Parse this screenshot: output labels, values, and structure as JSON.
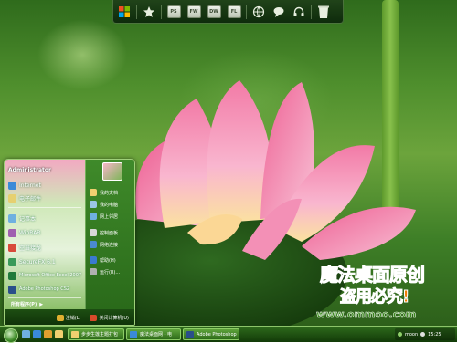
{
  "dock": {
    "items": [
      {
        "name": "windows-logo-icon"
      },
      {
        "name": "star-icon"
      },
      {
        "name": "photoshop-app",
        "label": "PS"
      },
      {
        "name": "fireworks-app",
        "label": "FW"
      },
      {
        "name": "dreamweaver-app",
        "label": "DW"
      },
      {
        "name": "flash-app",
        "label": "FL"
      },
      {
        "name": "internet-icon"
      },
      {
        "name": "messenger-icon"
      },
      {
        "name": "headphones-icon"
      },
      {
        "name": "recycle-bin-icon"
      }
    ]
  },
  "start_menu": {
    "user": "Administrator",
    "pinned": [
      "Internet",
      "电子邮件"
    ],
    "recent": [
      "记事本",
      "WinRAR",
      "空当接龙",
      "SecureFX 6.1",
      "Microsoft Office Excel 2007",
      "Adobe Photoshop CS2"
    ],
    "all_programs": "所有程序(P)",
    "right_items": [
      "我的文档",
      "我的电脑",
      "网上邻居",
      "控制面板",
      "网络连接",
      "帮助(H)",
      "运行(R)..."
    ],
    "logoff": "注销(L)",
    "shutdown": "关闭计算机(U)"
  },
  "watermark": {
    "line1": "魔法桌面原创",
    "line2": "盗用必究!",
    "line3": "www.ommoo.com"
  },
  "taskbar": {
    "tasks": [
      "步步生莲主题打包",
      "魔法桌面网 - 电",
      "Adobe Photoshop"
    ],
    "tray_label": "moon",
    "clock": "15:25"
  },
  "colors": {
    "taskbar": "#2e6a1c",
    "accent": "#9fd07a",
    "watermark_orange": "#ff6a1a"
  }
}
